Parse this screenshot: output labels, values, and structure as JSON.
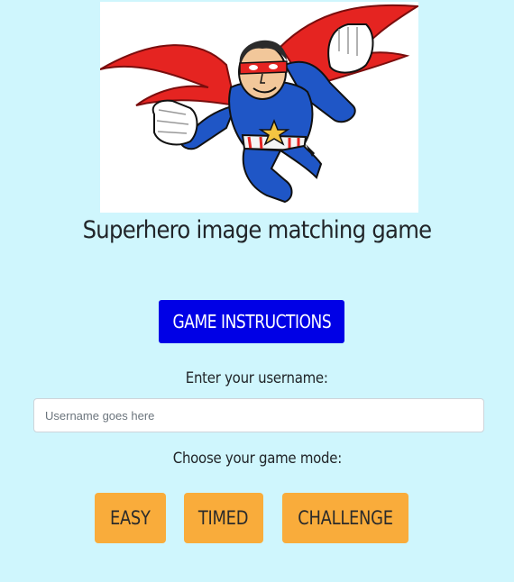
{
  "page": {
    "title": "Superhero image matching game",
    "hero_image": "superhero-illustration"
  },
  "instructions_button": {
    "label": "GAME INSTRUCTIONS"
  },
  "username": {
    "label": "Enter your username:",
    "placeholder": "Username goes here",
    "value": ""
  },
  "game_mode": {
    "label": "Choose your game mode:",
    "modes": [
      "EASY",
      "TIMED",
      "CHALLENGE"
    ]
  },
  "colors": {
    "background": "#cff6fd",
    "instructions_button": "#0000e6",
    "mode_button": "#f9ac3b"
  }
}
